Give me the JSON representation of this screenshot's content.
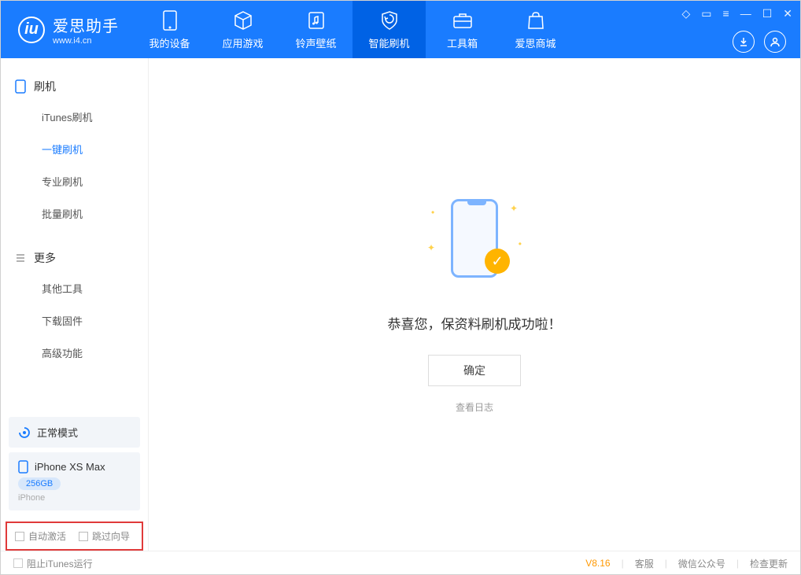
{
  "app": {
    "title": "爱思助手",
    "subtitle": "www.i4.cn"
  },
  "tabs": [
    {
      "label": "我的设备"
    },
    {
      "label": "应用游戏"
    },
    {
      "label": "铃声壁纸"
    },
    {
      "label": "智能刷机"
    },
    {
      "label": "工具箱"
    },
    {
      "label": "爱思商城"
    }
  ],
  "sidebar": {
    "section1": {
      "title": "刷机",
      "items": [
        "iTunes刷机",
        "一键刷机",
        "专业刷机",
        "批量刷机"
      ]
    },
    "section2": {
      "title": "更多",
      "items": [
        "其他工具",
        "下载固件",
        "高级功能"
      ]
    },
    "mode": "正常模式",
    "device": {
      "name": "iPhone XS Max",
      "storage": "256GB",
      "type": "iPhone"
    },
    "opts": {
      "auto": "自动激活",
      "skip": "跳过向导"
    }
  },
  "main": {
    "message": "恭喜您，保资料刷机成功啦！",
    "ok": "确定",
    "log": "查看日志"
  },
  "footer": {
    "block": "阻止iTunes运行",
    "version": "V8.16",
    "links": [
      "客服",
      "微信公众号",
      "检查更新"
    ]
  }
}
